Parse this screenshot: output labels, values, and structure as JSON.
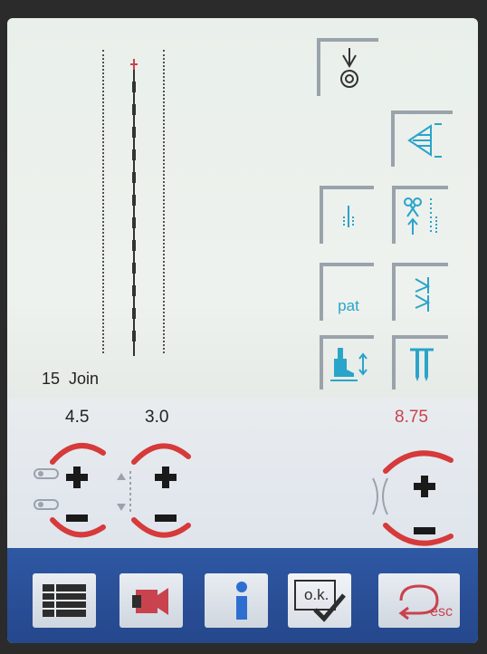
{
  "pattern": {
    "number": "15",
    "name": "Join"
  },
  "controls": {
    "stitch_width": "4.5",
    "stitch_length": "3.0",
    "tension_value": "8.75"
  },
  "tiles": {
    "pattern_extension": "pat"
  },
  "taskbar": {
    "ok_label": "o.k.",
    "esc_label": "esc"
  },
  "colors": {
    "accent_blue": "#2aa4c9",
    "tension_red": "#c9434e",
    "dial_red": "#d63a3a",
    "taskbar_blue": "#2f58a3"
  },
  "icons": [
    "needle-stop-icon",
    "mirror-image-icon",
    "securing-stitch-icon",
    "thread-cut-icon",
    "pattern-end-icon",
    "triple-stitch-icon",
    "presser-foot-pressure-icon",
    "needle-position-icon",
    "menu-list-icon",
    "video-tutorial-icon",
    "info-icon",
    "ok-confirm-icon",
    "esc-back-icon"
  ]
}
